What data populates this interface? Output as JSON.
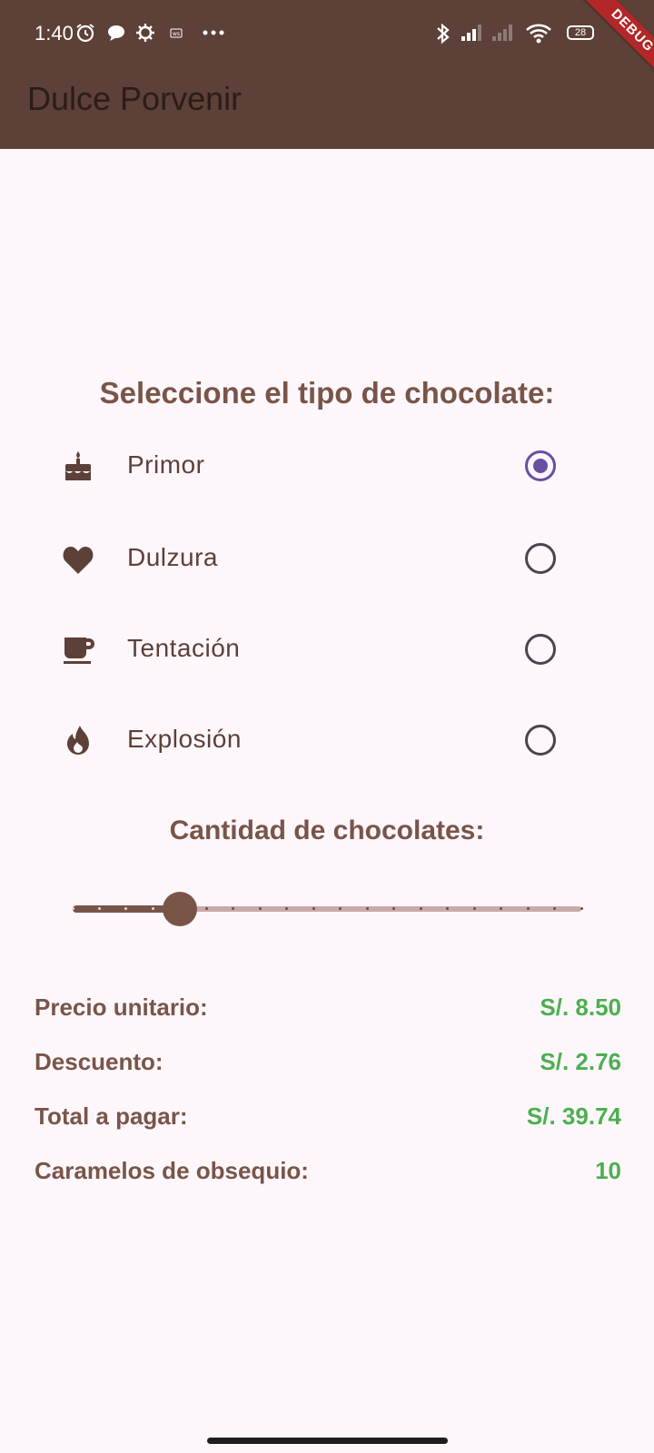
{
  "status_bar": {
    "time": "1:40",
    "battery_level": "28",
    "left_icons": [
      "alarm-icon",
      "chat-icon",
      "settings-icon",
      "app-notification-icon",
      "more-dots-icon"
    ],
    "right_icons": [
      "bluetooth-icon",
      "signal-icon",
      "signal-weak-icon",
      "wifi-icon",
      "battery-icon"
    ]
  },
  "debug_banner": "DEBUG",
  "app_bar": {
    "title": "Dulce Porvenir"
  },
  "chocolate_section": {
    "title": "Seleccione el tipo de chocolate:",
    "options": [
      {
        "label": "Primor",
        "icon": "cake-icon",
        "selected": true
      },
      {
        "label": "Dulzura",
        "icon": "heart-icon",
        "selected": false
      },
      {
        "label": "Tentación",
        "icon": "coffee-cup-icon",
        "selected": false
      },
      {
        "label": "Explosión",
        "icon": "fire-icon",
        "selected": false
      }
    ]
  },
  "quantity_section": {
    "title": "Cantidad de chocolates:",
    "slider": {
      "min": 1,
      "max": 20,
      "value": 5
    }
  },
  "summary": {
    "rows": [
      {
        "label": "Precio unitario:",
        "value": "S/. 8.50"
      },
      {
        "label": "Descuento:",
        "value": "S/. 2.76"
      },
      {
        "label": "Total a pagar:",
        "value": "S/. 39.74"
      },
      {
        "label": "Caramelos de obsequio:",
        "value": "10"
      }
    ]
  },
  "colors": {
    "app_bar": "#5d4037",
    "accent_brown": "#795548",
    "radio_selected": "#6750a4",
    "value_green": "#4caf50",
    "background": "#fdf7fc"
  }
}
